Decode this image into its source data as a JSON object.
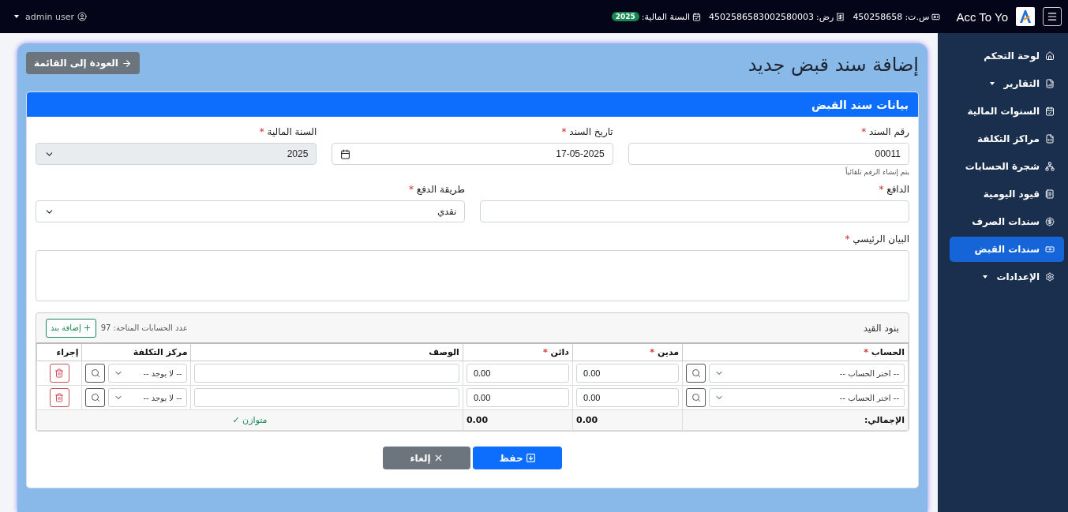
{
  "topbar": {
    "brand": "Acc To Yo",
    "info": [
      {
        "label": "س.ت:",
        "value": "450258658"
      },
      {
        "label": "رض:",
        "value": "4502586583002580003"
      },
      {
        "label": "السنة المالية:",
        "badge": "2025"
      }
    ],
    "user": "admin user"
  },
  "sidebar": {
    "items": [
      {
        "label": "لوحة التحكم",
        "selected": false,
        "submenu": false
      },
      {
        "label": "التقارير",
        "selected": false,
        "submenu": true
      },
      {
        "label": "السنوات المالية",
        "selected": false,
        "submenu": false
      },
      {
        "label": "مراكز التكلفة",
        "selected": false,
        "submenu": false
      },
      {
        "label": "شجرة الحسابات",
        "selected": false,
        "submenu": false
      },
      {
        "label": "قيود اليومية",
        "selected": false,
        "submenu": false
      },
      {
        "label": "سندات الصرف",
        "selected": false,
        "submenu": false
      },
      {
        "label": "سندات القبض",
        "selected": true,
        "submenu": false
      },
      {
        "label": "الإعدادات",
        "selected": false,
        "submenu": true
      }
    ]
  },
  "page": {
    "title": "إضافة سند قبض جديد",
    "back_button": "العودة إلى القائمة"
  },
  "card": {
    "title": "بيانات سند القبض",
    "rows": [
      [
        {
          "kind": "text",
          "label": "رقم السند",
          "mark": "*",
          "value": "00011",
          "help": "يتم إنشاء الرقم تلقائياً"
        },
        {
          "kind": "date",
          "label": "تاريخ السند",
          "mark": "*",
          "value": "17-05-2025"
        },
        {
          "kind": "select",
          "label": "السنة المالية",
          "mark": "*",
          "value": "2025",
          "disabled": true
        }
      ],
      [
        {
          "kind": "text",
          "label": "الدافع",
          "mark": "*"
        },
        {
          "kind": "select",
          "label": "طريقة الدفع",
          "mark": "*",
          "value": "نقدي",
          "disabled": false
        }
      ],
      [
        {
          "kind": "textarea",
          "label": "البيان الرئيسي",
          "mark": "*"
        }
      ]
    ],
    "lines": {
      "title": "بنود القيد",
      "count": "عدد الحسابات المتاحة: 97",
      "add_button": "إضافة بند",
      "columns": [
        {
          "label": "الحساب",
          "mark": "*"
        },
        {
          "label": "مدين",
          "mark": "*"
        },
        {
          "label": "دائن",
          "mark": "*"
        },
        {
          "label": "الوصف"
        },
        {
          "label": "مركز التكلفة"
        },
        {
          "label": "إجراء"
        }
      ],
      "rows": [
        {
          "account": "-- اختر الحساب --",
          "debit": "0.00",
          "credit": "0.00",
          "cost_center": "-- لا يوجد --"
        },
        {
          "account": "-- اختر الحساب --",
          "debit": "0.00",
          "credit": "0.00",
          "cost_center": "-- لا يوجد --"
        }
      ],
      "totals": {
        "label": "الإجمالي:",
        "debit": "0.00",
        "credit": "0.00",
        "status": "متوازن ✓"
      }
    },
    "buttons": {
      "save": "حفظ",
      "cancel": "إلغاء"
    }
  }
}
